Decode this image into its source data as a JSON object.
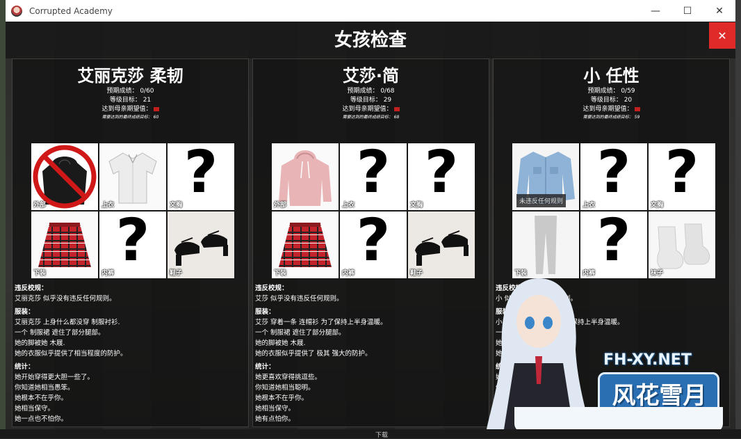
{
  "window": {
    "title": "Corrupted Academy"
  },
  "header": {
    "title": "女孩检查",
    "close": "✕"
  },
  "panels": [
    {
      "name": "艾丽克莎 柔韧",
      "expected": "预期成绩： 0/60",
      "goal": "等级目标： 21",
      "mother": "达到母亲期望值：",
      "final": "需要达到的最终成绩目标： 60",
      "cells": [
        {
          "label": "外部",
          "type": "banned-hoodie"
        },
        {
          "label": "上衣",
          "type": "white-shirt"
        },
        {
          "label": "文胸",
          "type": "unknown"
        },
        {
          "label": "下装",
          "type": "plaid-skirt"
        },
        {
          "label": "内裤",
          "type": "unknown"
        },
        {
          "label": "鞋子",
          "type": "black-shoes"
        }
      ],
      "violation_title": "违反校规：",
      "violation": "艾丽克莎 似乎没有违反任何规则。",
      "clothing_title": "服装：",
      "clothing": [
        "艾丽克莎 上身什么都没穿 制服衬衫.",
        "一个 制服裙 遮住了部分腿部。",
        "她的脚被她 木屐.",
        "她的衣服似乎提供了相当程度的防护。"
      ],
      "stats_title": "统计：",
      "stats": [
        "她开始穿得更大胆一些了。",
        "你知道她相当愚笨。",
        "她根本不在乎你。",
        "她相当保守。",
        "她一点也不怕你。"
      ]
    },
    {
      "name": "艾莎·简",
      "expected": "预期成绩： 0/68",
      "goal": "等级目标： 29",
      "mother": "达到母亲期望值：",
      "final": "需要达到的最终成绩目标： 68",
      "cells": [
        {
          "label": "外部",
          "type": "pink-hoodie"
        },
        {
          "label": "上衣",
          "type": "unknown"
        },
        {
          "label": "文胸",
          "type": "unknown"
        },
        {
          "label": "下装",
          "type": "plaid-skirt"
        },
        {
          "label": "内裤",
          "type": "unknown"
        },
        {
          "label": "鞋子",
          "type": "black-shoes"
        }
      ],
      "violation_title": "违反校规：",
      "violation": "艾莎 似乎没有违反任何规则。",
      "clothing_title": "服装：",
      "clothing": [
        "艾莎 穿着一条 连帽衫 为了保持上半身温暖。",
        "一个 制服裙 遮住了部分腿部。",
        "她的脚被她 木屐.",
        "她的衣服似乎提供了 极其 强大的防护。"
      ],
      "stats_title": "统计：",
      "stats": [
        "她更喜欢穿得挑逗些。",
        "你知道她相当聪明。",
        "她根本不在乎你。",
        "她相当保守。",
        "她有点怕你。"
      ]
    },
    {
      "name": "小 任性",
      "expected": "预期成绩： 0/59",
      "goal": "等级目标： 20",
      "mother": "达到母亲期望值：",
      "final": "需要达到的最终成绩目标： 59",
      "cells": [
        {
          "label": "",
          "type": "denim-jacket"
        },
        {
          "label": "上衣",
          "type": "unknown"
        },
        {
          "label": "文胸",
          "type": "unknown"
        },
        {
          "label": "下装",
          "type": "grey-leggings"
        },
        {
          "label": "内裤",
          "type": "unknown"
        },
        {
          "label": "袜子",
          "type": "white-socks"
        }
      ],
      "tooltip": "未违反任何规则",
      "violation_title": "违反校规：",
      "violation": "小 似乎没有违反任何规则。",
      "clothing_title": "服装：",
      "clothing": [
        "小 穿着一",
        "一条 打",
        "她的脚",
        "她的衣"
      ],
      "clothing_tails": [
        "了保持上半身温暖。",
        "的双腿。",
        "",
        "量防护。"
      ],
      "stats_title": "统计：",
      "stats": [
        "她穿",
        "你知",
        "她对",
        "她相",
        "她一"
      ]
    }
  ],
  "watermark": {
    "line1": "FH-XY.NET",
    "line2": "风花雪月"
  },
  "taskbar": {
    "label": "下载"
  }
}
